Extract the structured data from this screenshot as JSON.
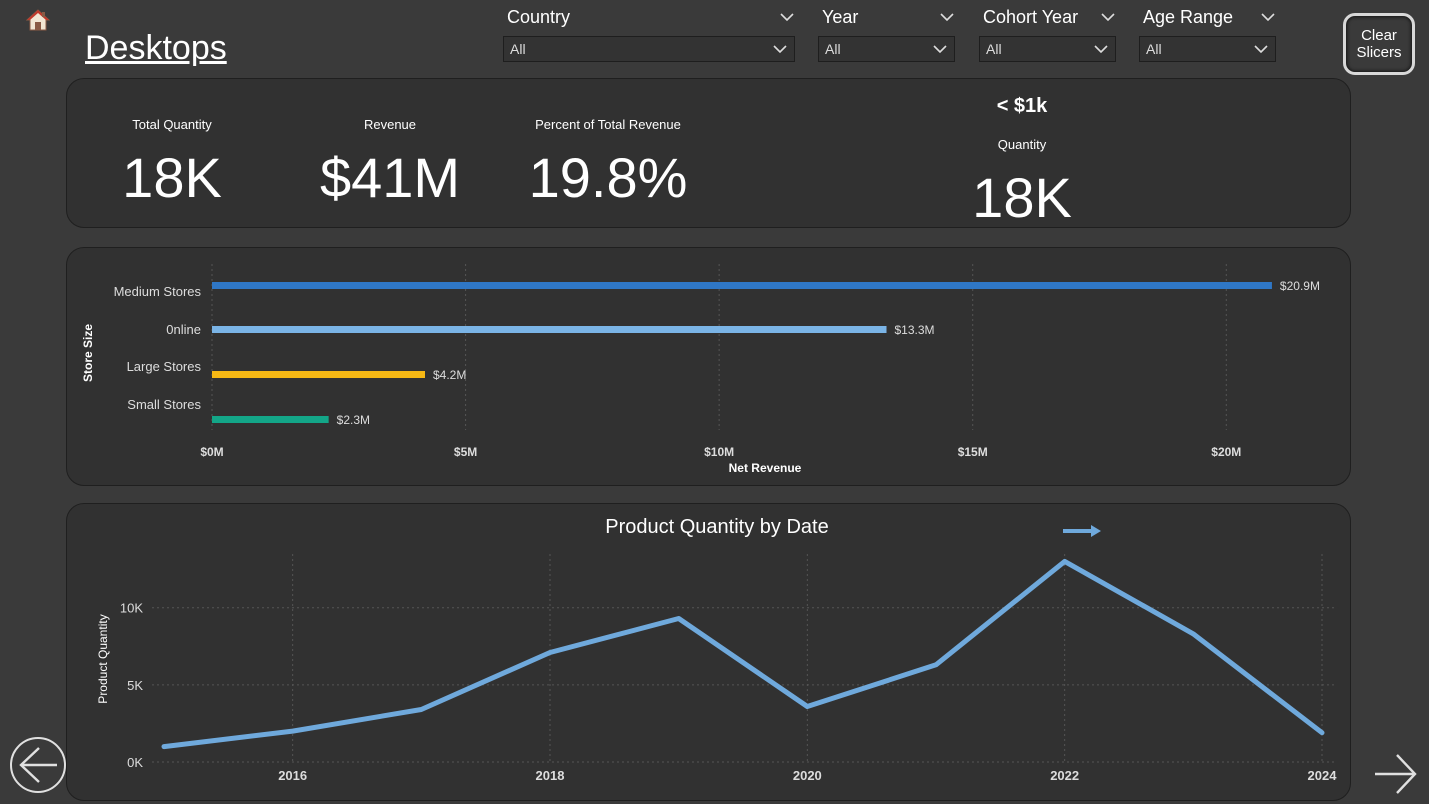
{
  "page": {
    "title": "Desktops"
  },
  "icons": {
    "home": "home-icon",
    "back": "back-arrow-icon",
    "forward": "forward-arrow-icon",
    "chevron": "chevron-down-icon"
  },
  "slicers": [
    {
      "title": "Country",
      "value": "All"
    },
    {
      "title": "Year",
      "value": "All"
    },
    {
      "title": "Cohort Year",
      "value": "All"
    },
    {
      "title": "Age Range",
      "value": "All"
    }
  ],
  "clear_button": {
    "label_line1": "Clear",
    "label_line2": "Slicers"
  },
  "kpis": {
    "total_quantity": {
      "label": "Total Quantity",
      "value": "18K"
    },
    "revenue": {
      "label": "Revenue",
      "value": "$41M"
    },
    "percent_revenue": {
      "label": "Percent of Total Revenue",
      "value": "19.8%"
    },
    "price_band": {
      "heading": "< $1k",
      "label": "Quantity",
      "value": "18K"
    }
  },
  "chart_data": [
    {
      "type": "bar",
      "orientation": "horizontal",
      "title": "",
      "xlabel": "Net Revenue",
      "ylabel": "Store Size",
      "categories": [
        "Medium Stores",
        "0nline",
        "Large Stores",
        "Small Stores"
      ],
      "values": [
        20.9,
        13.3,
        4.2,
        2.3
      ],
      "value_labels": [
        "$20.9M",
        "$13.3M",
        "$4.2M",
        "$2.3M"
      ],
      "unit": "M",
      "colors": [
        "#2f77c6",
        "#7ab4e6",
        "#f6b814",
        "#13a688"
      ],
      "xlim": [
        0,
        21
      ],
      "xticks": [
        0,
        5,
        10,
        15,
        20
      ],
      "xtick_labels": [
        "$0M",
        "$5M",
        "$10M",
        "$15M",
        "$20M"
      ],
      "grid": true
    },
    {
      "type": "line",
      "title": "Product Quantity by Date",
      "xlabel": "",
      "ylabel": "Product Quantity",
      "x": [
        2015,
        2016,
        2017,
        2018,
        2019,
        2020,
        2021,
        2022,
        2023,
        2024
      ],
      "series": [
        {
          "values": [
            1000,
            2000,
            3400,
            7100,
            9300,
            3600,
            6300,
            13000,
            8300,
            1900
          ]
        }
      ],
      "color": "#6fa9dc",
      "xlim": [
        2015,
        2024
      ],
      "ylim": [
        0,
        14000
      ],
      "xticks": [
        2016,
        2018,
        2020,
        2022,
        2024
      ],
      "xtick_labels": [
        "2016",
        "2018",
        "2020",
        "2022",
        "2024"
      ],
      "yticks": [
        0,
        5000,
        10000
      ],
      "ytick_labels": [
        "0K",
        "5K",
        "10K"
      ],
      "grid": true
    }
  ]
}
